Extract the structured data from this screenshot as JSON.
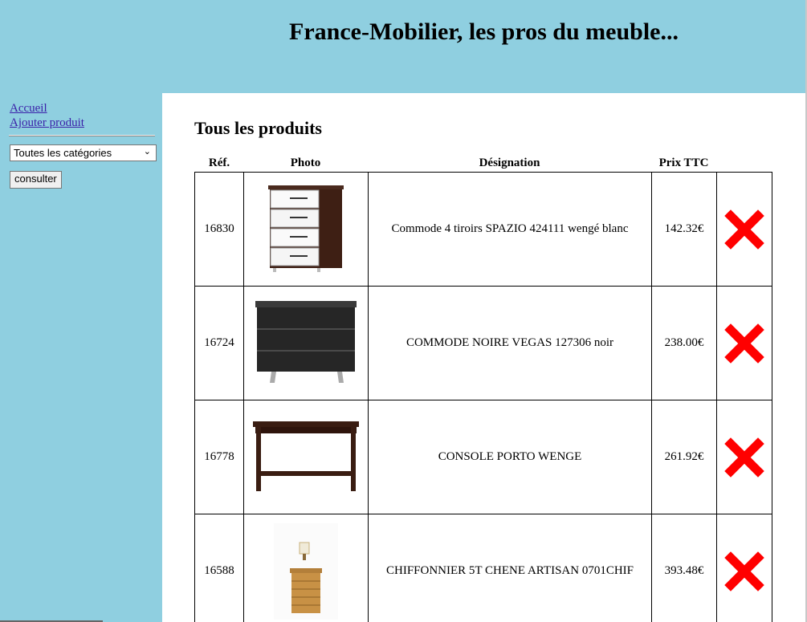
{
  "header": {
    "title": "France-Mobilier, les pros du meuble..."
  },
  "sidebar": {
    "links": [
      {
        "label": "Accueil"
      },
      {
        "label": "Ajouter produit"
      }
    ],
    "category_select": {
      "selected": "Toutes les catégories"
    },
    "submit_label": "consulter"
  },
  "main": {
    "heading": "Tous les produits",
    "columns": {
      "ref": "Réf.",
      "photo": "Photo",
      "designation": "Désignation",
      "price": "Prix TTC"
    },
    "products": [
      {
        "ref": "16830",
        "designation": "Commode 4 tiroirs SPAZIO 424111 wengé blanc",
        "price": "142.32€",
        "photo_icon": "white-drawer-dresser"
      },
      {
        "ref": "16724",
        "designation": "COMMODE NOIRE VEGAS 127306 noir",
        "price": "238.00€",
        "photo_icon": "black-dresser"
      },
      {
        "ref": "16778",
        "designation": "CONSOLE PORTO WENGE",
        "price": "261.92€",
        "photo_icon": "console-table"
      },
      {
        "ref": "16588",
        "designation": "CHIFFONNIER 5T CHENE ARTISAN 0701CHIF",
        "price": "393.48€",
        "photo_icon": "oak-chiffonier"
      }
    ]
  },
  "colors": {
    "background": "#8fcfe0",
    "content": "#ffffff",
    "link": "#3a1fa8",
    "delete": "#ff0000"
  }
}
